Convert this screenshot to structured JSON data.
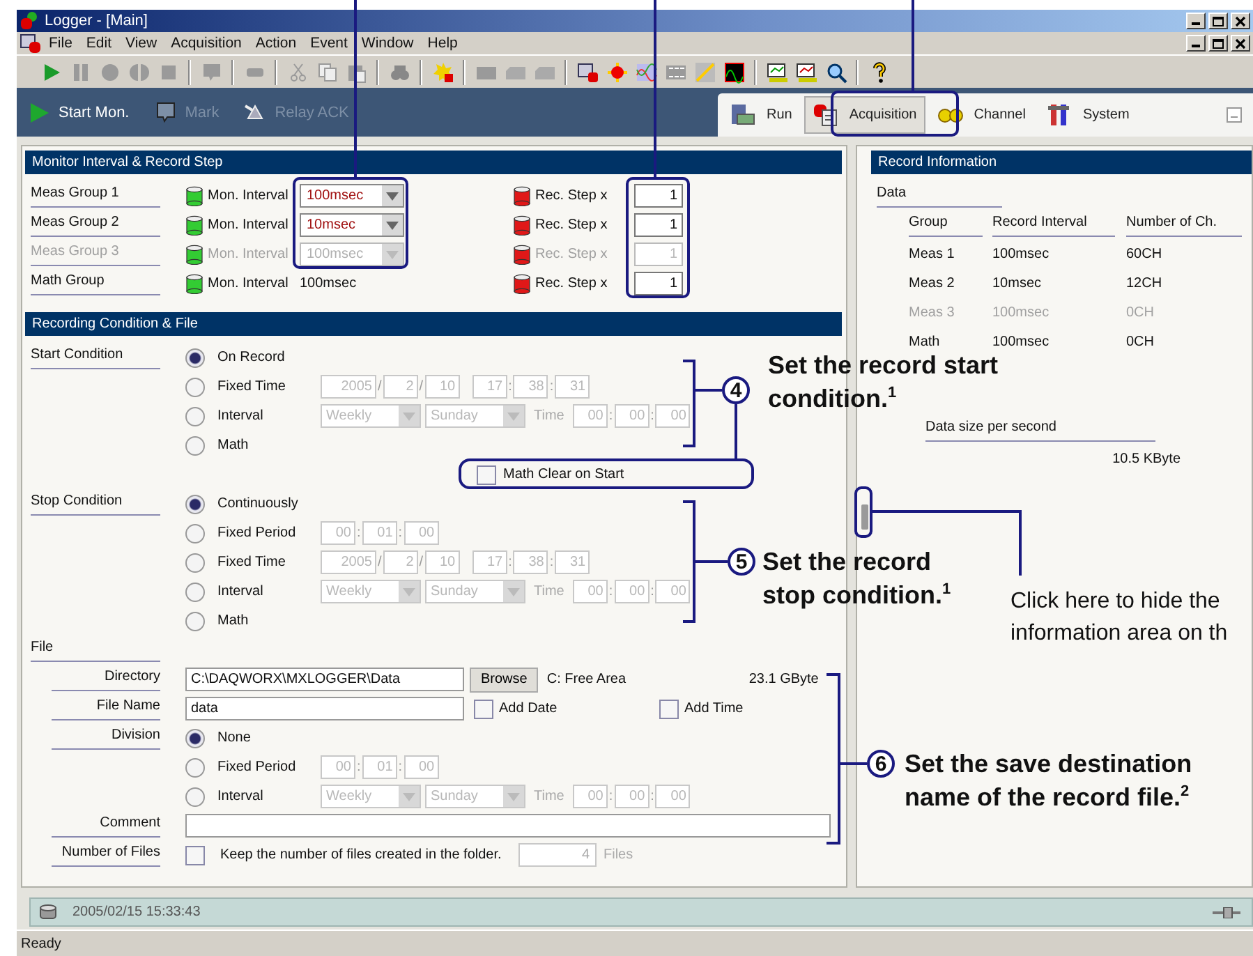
{
  "window": {
    "title": "Logger - [Main]"
  },
  "menu": [
    "File",
    "Edit",
    "View",
    "Acquisition",
    "Action",
    "Event",
    "Window",
    "Help"
  ],
  "command_buttons": [
    {
      "label": "Start Mon.",
      "disabled": false,
      "kind": "start"
    },
    {
      "label": "Mark",
      "disabled": true,
      "kind": "mark"
    },
    {
      "label": "Relay ACK",
      "disabled": true,
      "kind": "relay"
    }
  ],
  "view_tabs": [
    {
      "label": "Run",
      "selected": false,
      "kind": "run"
    },
    {
      "label": "Acquisition",
      "selected": true,
      "kind": "acquisition"
    },
    {
      "label": "Channel",
      "selected": false,
      "kind": "channel"
    },
    {
      "label": "System",
      "selected": false,
      "kind": "system"
    }
  ],
  "monitor": {
    "title": "Monitor Interval & Record Step",
    "groups": [
      {
        "name": "Meas Group 1",
        "disabled": false,
        "interval_label": "Mon. Interval",
        "kind": "dropdown",
        "interval": "100msec",
        "step_label": "Rec. Step x",
        "step": "1"
      },
      {
        "name": "Meas Group 2",
        "disabled": false,
        "interval_label": "Mon. Interval",
        "kind": "dropdown",
        "interval": "10msec",
        "step_label": "Rec. Step x",
        "step": "1"
      },
      {
        "name": "Meas Group 3",
        "disabled": true,
        "interval_label": "Mon. Interval",
        "kind": "dropdown",
        "interval": "100msec",
        "step_label": "Rec. Step x",
        "step": "1"
      },
      {
        "name": "Math Group",
        "disabled": false,
        "interval_label": "Mon. Interval",
        "kind": "text",
        "interval": "100msec",
        "step_label": "Rec. Step x",
        "step": "1"
      }
    ]
  },
  "recording": {
    "title": "Recording Condition & File",
    "start_condition": {
      "label": "Start Condition",
      "options": [
        {
          "label": "On Record",
          "selected": true
        },
        {
          "label": "Fixed Time",
          "selected": false,
          "parts": [
            {
              "kind": "box",
              "text": "2005"
            },
            {
              "kind": "sep",
              "text": "/"
            },
            {
              "kind": "box",
              "text": "2"
            },
            {
              "kind": "sep",
              "text": "/"
            },
            {
              "kind": "box",
              "text": "10"
            },
            {
              "kind": "box",
              "text": "17"
            },
            {
              "kind": "sep",
              "text": ":"
            },
            {
              "kind": "box",
              "text": "38"
            },
            {
              "kind": "sep",
              "text": ":"
            },
            {
              "kind": "box",
              "text": "31"
            }
          ]
        },
        {
          "label": "Interval",
          "selected": false,
          "parts": [
            {
              "kind": "select",
              "text": "Weekly"
            },
            {
              "kind": "select",
              "text": "Sunday"
            },
            {
              "kind": "label",
              "text": "Time"
            },
            {
              "kind": "box",
              "text": "00"
            },
            {
              "kind": "sep",
              "text": ":"
            },
            {
              "kind": "box",
              "text": "00"
            },
            {
              "kind": "sep",
              "text": ":"
            },
            {
              "kind": "box",
              "text": "00"
            }
          ]
        },
        {
          "label": "Math",
          "selected": false
        }
      ]
    },
    "math_clear": {
      "label": "Math Clear on Start",
      "checked": false
    },
    "stop_condition": {
      "label": "Stop Condition",
      "options": [
        {
          "label": "Continuously",
          "selected": true
        },
        {
          "label": "Fixed Period",
          "selected": false,
          "parts": [
            {
              "kind": "box",
              "text": "00"
            },
            {
              "kind": "sep",
              "text": ":"
            },
            {
              "kind": "box",
              "text": "01"
            },
            {
              "kind": "sep",
              "text": ":"
            },
            {
              "kind": "box",
              "text": "00"
            }
          ]
        },
        {
          "label": "Fixed Time",
          "selected": false,
          "parts": [
            {
              "kind": "box",
              "text": "2005"
            },
            {
              "kind": "sep",
              "text": "/"
            },
            {
              "kind": "box",
              "text": "2"
            },
            {
              "kind": "sep",
              "text": "/"
            },
            {
              "kind": "box",
              "text": "10"
            },
            {
              "kind": "box",
              "text": "17"
            },
            {
              "kind": "sep",
              "text": ":"
            },
            {
              "kind": "box",
              "text": "38"
            },
            {
              "kind": "sep",
              "text": ":"
            },
            {
              "kind": "box",
              "text": "31"
            }
          ]
        },
        {
          "label": "Interval",
          "selected": false,
          "parts": [
            {
              "kind": "select",
              "text": "Weekly"
            },
            {
              "kind": "select",
              "text": "Sunday"
            },
            {
              "kind": "label",
              "text": "Time"
            },
            {
              "kind": "box",
              "text": "00"
            },
            {
              "kind": "sep",
              "text": ":"
            },
            {
              "kind": "box",
              "text": "00"
            },
            {
              "kind": "sep",
              "text": ":"
            },
            {
              "kind": "box",
              "text": "00"
            }
          ]
        },
        {
          "label": "Math",
          "selected": false
        }
      ]
    },
    "file": {
      "label": "File",
      "directory": {
        "label": "Directory",
        "value": "C:\\DAQWORX\\MXLOGGER\\Data",
        "button": "Browse",
        "free_label": "C: Free Area",
        "free_value": "23.1 GByte"
      },
      "file_name": {
        "label": "File Name",
        "value": "data",
        "options": [
          {
            "label": "Add Date",
            "checked": false
          },
          {
            "label": "Add Time",
            "checked": false
          }
        ]
      },
      "division": {
        "label": "Division",
        "options": [
          {
            "label": "None",
            "selected": true
          },
          {
            "label": "Fixed Period",
            "selected": false,
            "parts": [
              {
                "kind": "box",
                "text": "00"
              },
              {
                "kind": "sep",
                "text": ":"
              },
              {
                "kind": "box",
                "text": "01"
              },
              {
                "kind": "sep",
                "text": ":"
              },
              {
                "kind": "box",
                "text": "00"
              }
            ]
          },
          {
            "label": "Interval",
            "selected": false,
            "parts": [
              {
                "kind": "select",
                "text": "Weekly"
              },
              {
                "kind": "select",
                "text": "Sunday"
              },
              {
                "kind": "label",
                "text": "Time"
              },
              {
                "kind": "box",
                "text": "00"
              },
              {
                "kind": "sep",
                "text": ":"
              },
              {
                "kind": "box",
                "text": "00"
              },
              {
                "kind": "sep",
                "text": ":"
              },
              {
                "kind": "box",
                "text": "00"
              }
            ]
          }
        ]
      },
      "comment": {
        "label": "Comment"
      },
      "number_of_files": {
        "label": "Number of Files",
        "checked": false,
        "text": "Keep the number of files created in the folder.",
        "count": "4",
        "unit": "Files"
      }
    }
  },
  "record_info": {
    "title": "Record Information",
    "data_label": "Data",
    "columns": [
      "Group",
      "Record Interval",
      "Number of Ch."
    ],
    "rows": [
      {
        "cells": [
          "Meas 1",
          "100msec",
          "60CH"
        ],
        "disabled": false
      },
      {
        "cells": [
          "Meas 2",
          "10msec",
          "12CH"
        ],
        "disabled": false
      },
      {
        "cells": [
          "Meas 3",
          "100msec",
          "0CH"
        ],
        "disabled": true
      },
      {
        "cells": [
          "Math",
          "100msec",
          "0CH"
        ],
        "disabled": false
      }
    ],
    "size_label": "Data size per second",
    "size_value": "10.5 KByte"
  },
  "footer": {
    "timestamp": "2005/02/15 15:33:43"
  },
  "status_bar": {
    "text": "Ready"
  },
  "callouts": [
    {
      "kind": "step",
      "number": "4",
      "lines": [
        "Set the record start",
        "condition.$^{1}$"
      ]
    },
    {
      "kind": "step",
      "number": "5",
      "lines": [
        "Set the record",
        "stop condition.$^{1}$"
      ]
    },
    {
      "kind": "note",
      "lines": [
        "Click here to hide the",
        "information area on th"
      ]
    },
    {
      "kind": "step",
      "number": "6",
      "lines": [
        "Set the save destination",
        "name of the record file.$^{2}$"
      ]
    }
  ]
}
